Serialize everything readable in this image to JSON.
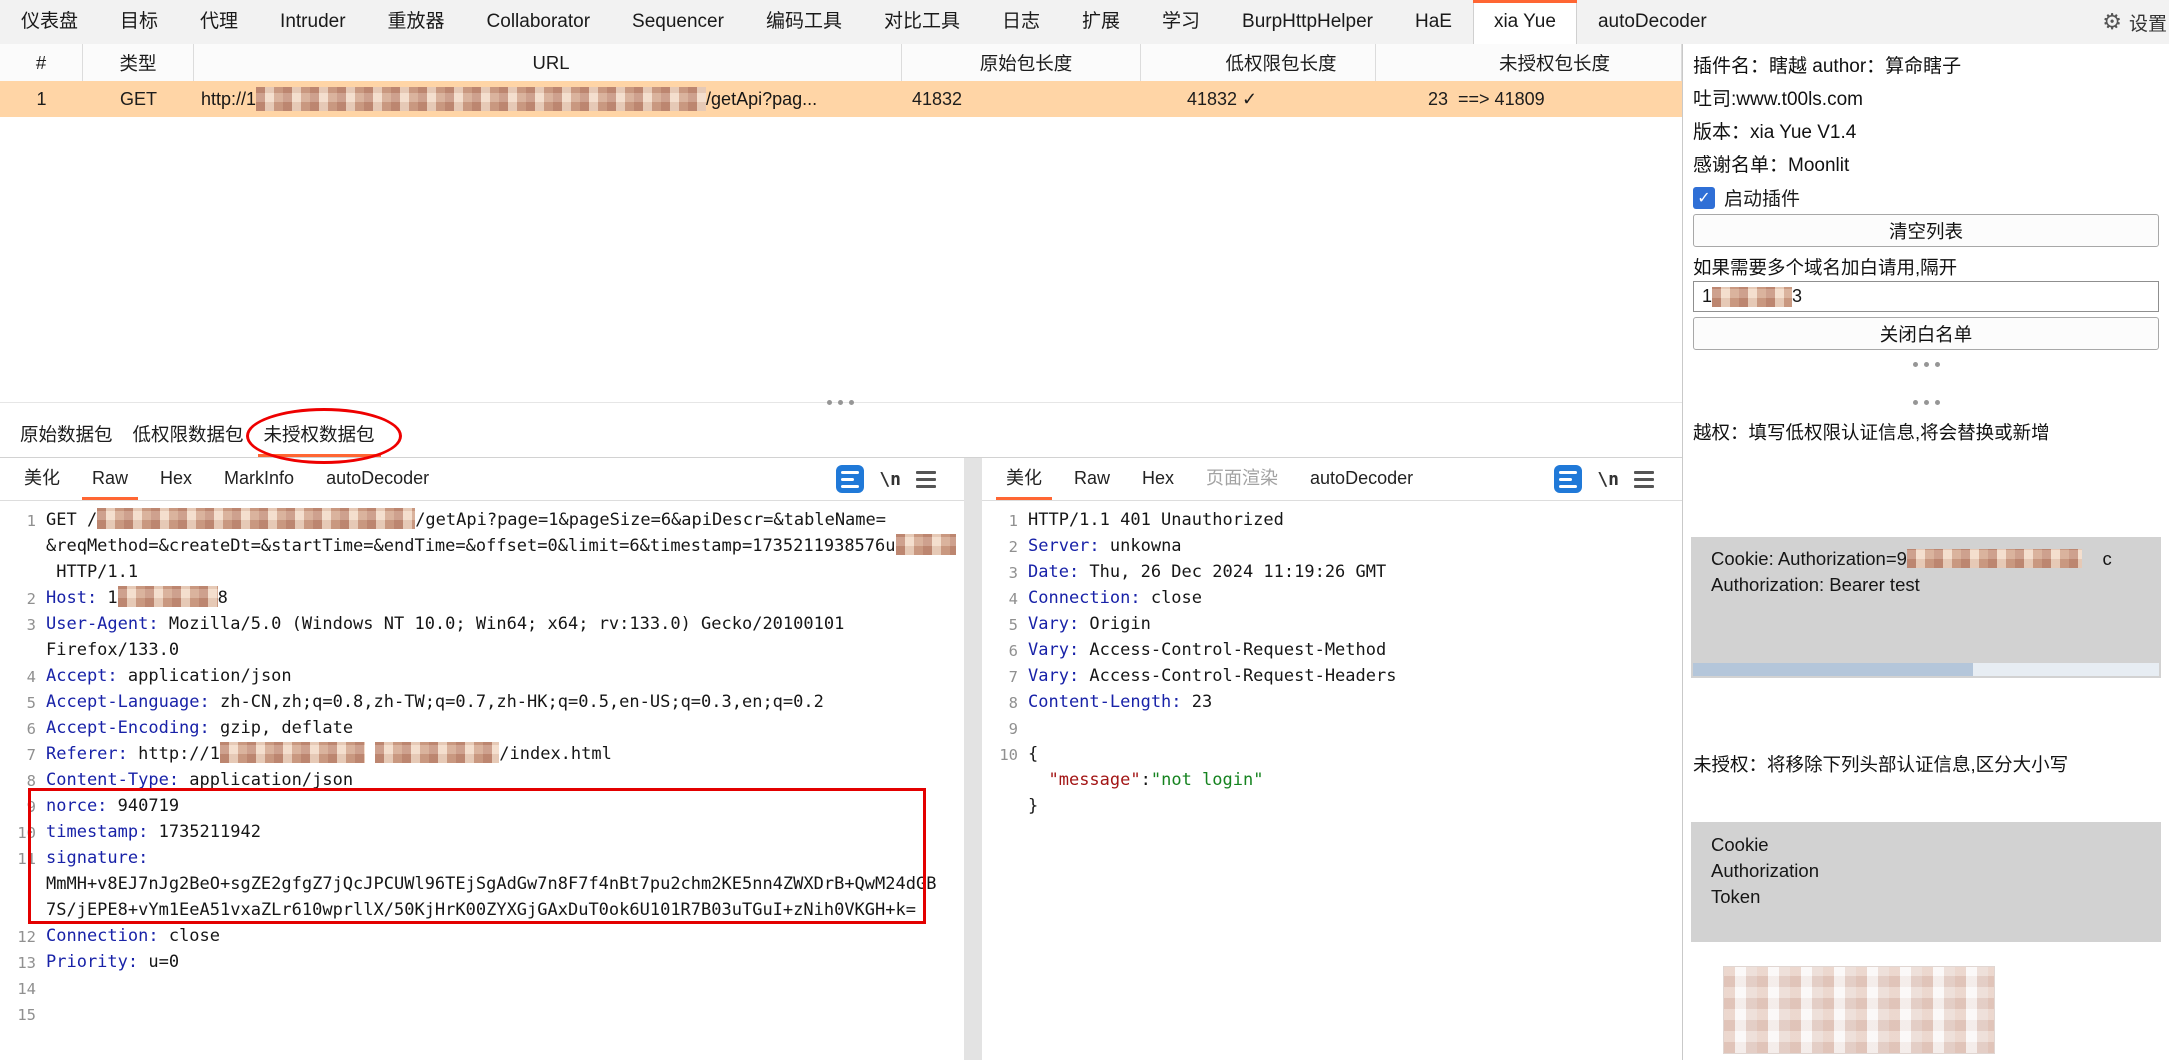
{
  "menu": {
    "items": [
      {
        "label": "仪表盘"
      },
      {
        "label": "目标"
      },
      {
        "label": "代理"
      },
      {
        "label": "Intruder"
      },
      {
        "label": "重放器"
      },
      {
        "label": "Collaborator"
      },
      {
        "label": "Sequencer"
      },
      {
        "label": "编码工具"
      },
      {
        "label": "对比工具"
      },
      {
        "label": "日志"
      },
      {
        "label": "扩展"
      },
      {
        "label": "学习"
      },
      {
        "label": "BurpHttpHelper"
      },
      {
        "label": "HaE"
      },
      {
        "label": "xia Yue",
        "selected": true
      },
      {
        "label": "autoDecoder"
      }
    ],
    "settings_label": "设置"
  },
  "table": {
    "headers": [
      "#",
      "类型",
      "URL",
      "原始包长度",
      "低权限包长度",
      "未授权包长度"
    ],
    "row": {
      "cells": [
        {
          "text": "1"
        },
        {
          "text": "GET"
        },
        {
          "segs": [
            {
              "t": "http://1"
            },
            {
              "r": 450
            },
            {
              "t": "/getApi?pag..."
            }
          ]
        },
        {
          "text": "41832"
        },
        {
          "text": "41832 ✓"
        },
        {
          "text": "23  ==> 41809"
        }
      ]
    }
  },
  "packet_tabs": {
    "items": [
      {
        "label": "原始数据包"
      },
      {
        "label": "低权限数据包"
      },
      {
        "label": "未授权数据包",
        "selected": true
      }
    ]
  },
  "ui": {
    "newline_icon": "\\n"
  },
  "request_editor": {
    "tabs": [
      {
        "label": "美化"
      },
      {
        "label": "Raw",
        "selected": true
      },
      {
        "label": "Hex"
      },
      {
        "label": "MarkInfo"
      },
      {
        "label": "autoDecoder"
      }
    ],
    "lines": [
      {
        "n": "1",
        "segs": [
          {
            "t": "GET /",
            "c": "val"
          },
          {
            "r": 318
          },
          {
            "t": "/getApi?page=1&pageSize=6&apiDescr=&tableName=",
            "c": "val"
          }
        ]
      },
      {
        "n": "",
        "segs": [
          {
            "t": "&reqMethod=&createDt=&startTime=&endTime=&offset=0&limit=6&timestamp=1735211938576u",
            "c": "val"
          },
          {
            "r": 60
          }
        ]
      },
      {
        "n": "",
        "segs": [
          {
            "t": " HTTP/1.1",
            "c": "val"
          }
        ]
      },
      {
        "n": "2",
        "segs": [
          {
            "t": "Host:",
            "c": "name"
          },
          {
            "t": " 1",
            "c": "val"
          },
          {
            "r": 100
          },
          {
            "t": "8",
            "c": "val"
          }
        ]
      },
      {
        "n": "3",
        "segs": [
          {
            "t": "User-Agent:",
            "c": "name"
          },
          {
            "t": " Mozilla/5.0 (Windows NT 10.0; Win64; x64; rv:133.0) Gecko/20100101",
            "c": "val"
          }
        ]
      },
      {
        "n": "",
        "segs": [
          {
            "t": "Firefox/133.0",
            "c": "val"
          }
        ]
      },
      {
        "n": "4",
        "segs": [
          {
            "t": "Accept:",
            "c": "name"
          },
          {
            "t": " application/json",
            "c": "val"
          }
        ]
      },
      {
        "n": "5",
        "segs": [
          {
            "t": "Accept-Language:",
            "c": "name"
          },
          {
            "t": " zh-CN,zh;q=0.8,zh-TW;q=0.7,zh-HK;q=0.5,en-US;q=0.3,en;q=0.2",
            "c": "val"
          }
        ]
      },
      {
        "n": "6",
        "segs": [
          {
            "t": "Accept-Encoding:",
            "c": "name"
          },
          {
            "t": " gzip, deflate",
            "c": "val"
          }
        ]
      },
      {
        "n": "7",
        "segs": [
          {
            "t": "Referer:",
            "c": "name"
          },
          {
            "t": " http://1",
            "c": "val"
          },
          {
            "r": 145
          },
          {
            "t": " ",
            "c": "val"
          },
          {
            "r": 124
          },
          {
            "t": "/index.html",
            "c": "val"
          }
        ]
      },
      {
        "n": "8",
        "segs": [
          {
            "t": "Content-Type:",
            "c": "name"
          },
          {
            "t": " application/json",
            "c": "val"
          }
        ]
      },
      {
        "n": "9",
        "segs": [
          {
            "t": "norce:",
            "c": "name"
          },
          {
            "t": " 940719",
            "c": "val"
          }
        ]
      },
      {
        "n": "10",
        "segs": [
          {
            "t": "timestamp:",
            "c": "name"
          },
          {
            "t": " 1735211942",
            "c": "val"
          }
        ]
      },
      {
        "n": "11",
        "segs": [
          {
            "t": "signature:",
            "c": "name"
          }
        ]
      },
      {
        "n": "",
        "segs": [
          {
            "t": "MmMH+v8EJ7nJg2BeO+sgZE2gfgZ7jQcJPCUWl96TEjSgAdGw7n8F7f4nBt7pu2chm2KE5nn4ZWXDrB+QwM24dGB",
            "c": "val"
          }
        ]
      },
      {
        "n": "",
        "segs": [
          {
            "t": "7S/jEPE8+vYm1EeA51vxaZLr610wprllX/50KjHrK00ZYXGjGAxDuT0ok6U101R7B03uTGuI+zNih0VKGH+k=",
            "c": "val"
          }
        ]
      },
      {
        "n": "12",
        "segs": [
          {
            "t": "Connection:",
            "c": "name"
          },
          {
            "t": " close",
            "c": "val"
          }
        ]
      },
      {
        "n": "13",
        "segs": [
          {
            "t": "Priority:",
            "c": "name"
          },
          {
            "t": " u=0",
            "c": "val"
          }
        ]
      },
      {
        "n": "14",
        "segs": []
      },
      {
        "n": "15",
        "segs": []
      }
    ]
  },
  "response_editor": {
    "tabs": [
      {
        "label": "美化",
        "selected": true
      },
      {
        "label": "Raw"
      },
      {
        "label": "Hex"
      },
      {
        "label": "页面渲染",
        "disabled": true
      },
      {
        "label": "autoDecoder"
      }
    ],
    "lines": [
      {
        "n": "1",
        "segs": [
          {
            "t": "HTTP/1.1 401 Unauthorized",
            "c": "val"
          }
        ]
      },
      {
        "n": "2",
        "segs": [
          {
            "t": "Server:",
            "c": "name"
          },
          {
            "t": " unkowna",
            "c": "val"
          }
        ]
      },
      {
        "n": "3",
        "segs": [
          {
            "t": "Date:",
            "c": "name"
          },
          {
            "t": " Thu, 26 Dec 2024 11:19:26 GMT",
            "c": "val"
          }
        ]
      },
      {
        "n": "4",
        "segs": [
          {
            "t": "Connection:",
            "c": "name"
          },
          {
            "t": " close",
            "c": "val"
          }
        ]
      },
      {
        "n": "5",
        "segs": [
          {
            "t": "Vary:",
            "c": "name"
          },
          {
            "t": " Origin",
            "c": "val"
          }
        ]
      },
      {
        "n": "6",
        "segs": [
          {
            "t": "Vary:",
            "c": "name"
          },
          {
            "t": " Access-Control-Request-Method",
            "c": "val"
          }
        ]
      },
      {
        "n": "7",
        "segs": [
          {
            "t": "Vary:",
            "c": "name"
          },
          {
            "t": " Access-Control-Request-Headers",
            "c": "val"
          }
        ]
      },
      {
        "n": "8",
        "segs": [
          {
            "t": "Content-Length:",
            "c": "name"
          },
          {
            "t": " 23",
            "c": "val"
          }
        ]
      },
      {
        "n": "9",
        "segs": []
      },
      {
        "n": "10",
        "segs": [
          {
            "t": "{",
            "c": "val"
          }
        ]
      },
      {
        "n": "",
        "segs": [
          {
            "t": "  ",
            "c": "val"
          },
          {
            "t": "\"message\"",
            "c": "key"
          },
          {
            "t": ":",
            "c": "val"
          },
          {
            "t": "\"not login\"",
            "c": "grn"
          }
        ]
      },
      {
        "n": "",
        "segs": [
          {
            "t": "}",
            "c": "val"
          }
        ]
      }
    ]
  },
  "sidebar": {
    "info_lines": [
      "插件名：瞎越 author：算命瞎子",
      "吐司:www.t00ls.com",
      "版本：xia Yue V1.4",
      "感谢名单：Moonlit"
    ],
    "enable_label": "启动插件",
    "clear_button": "清空列表",
    "whitelist_hint": "如果需要多个域名加白请用,隔开",
    "whitelist": {
      "segs": [
        {
          "t": "1"
        },
        {
          "r": 80
        },
        {
          "t": "3"
        }
      ]
    },
    "close_whitelist_button": "关闭白名单",
    "privilege_hint": "越权：填写低权限认证信息,将会替换或新增",
    "privilege_box": {
      "lines": [
        {
          "segs": [
            {
              "t": "Cookie: Authorization=9"
            },
            {
              "r": 175
            },
            {
              "t": "    c"
            }
          ]
        },
        {
          "segs": [
            {
              "t": "Authorization: Bearer test"
            }
          ]
        }
      ]
    },
    "unauth_hint": "未授权：将移除下列头部认证信息,区分大小写",
    "unauth_box": {
      "lines": [
        {
          "segs": [
            {
              "t": "Cookie"
            }
          ]
        },
        {
          "segs": [
            {
              "t": "Authorization"
            }
          ]
        },
        {
          "segs": [
            {
              "t": "Token"
            }
          ]
        }
      ]
    }
  }
}
